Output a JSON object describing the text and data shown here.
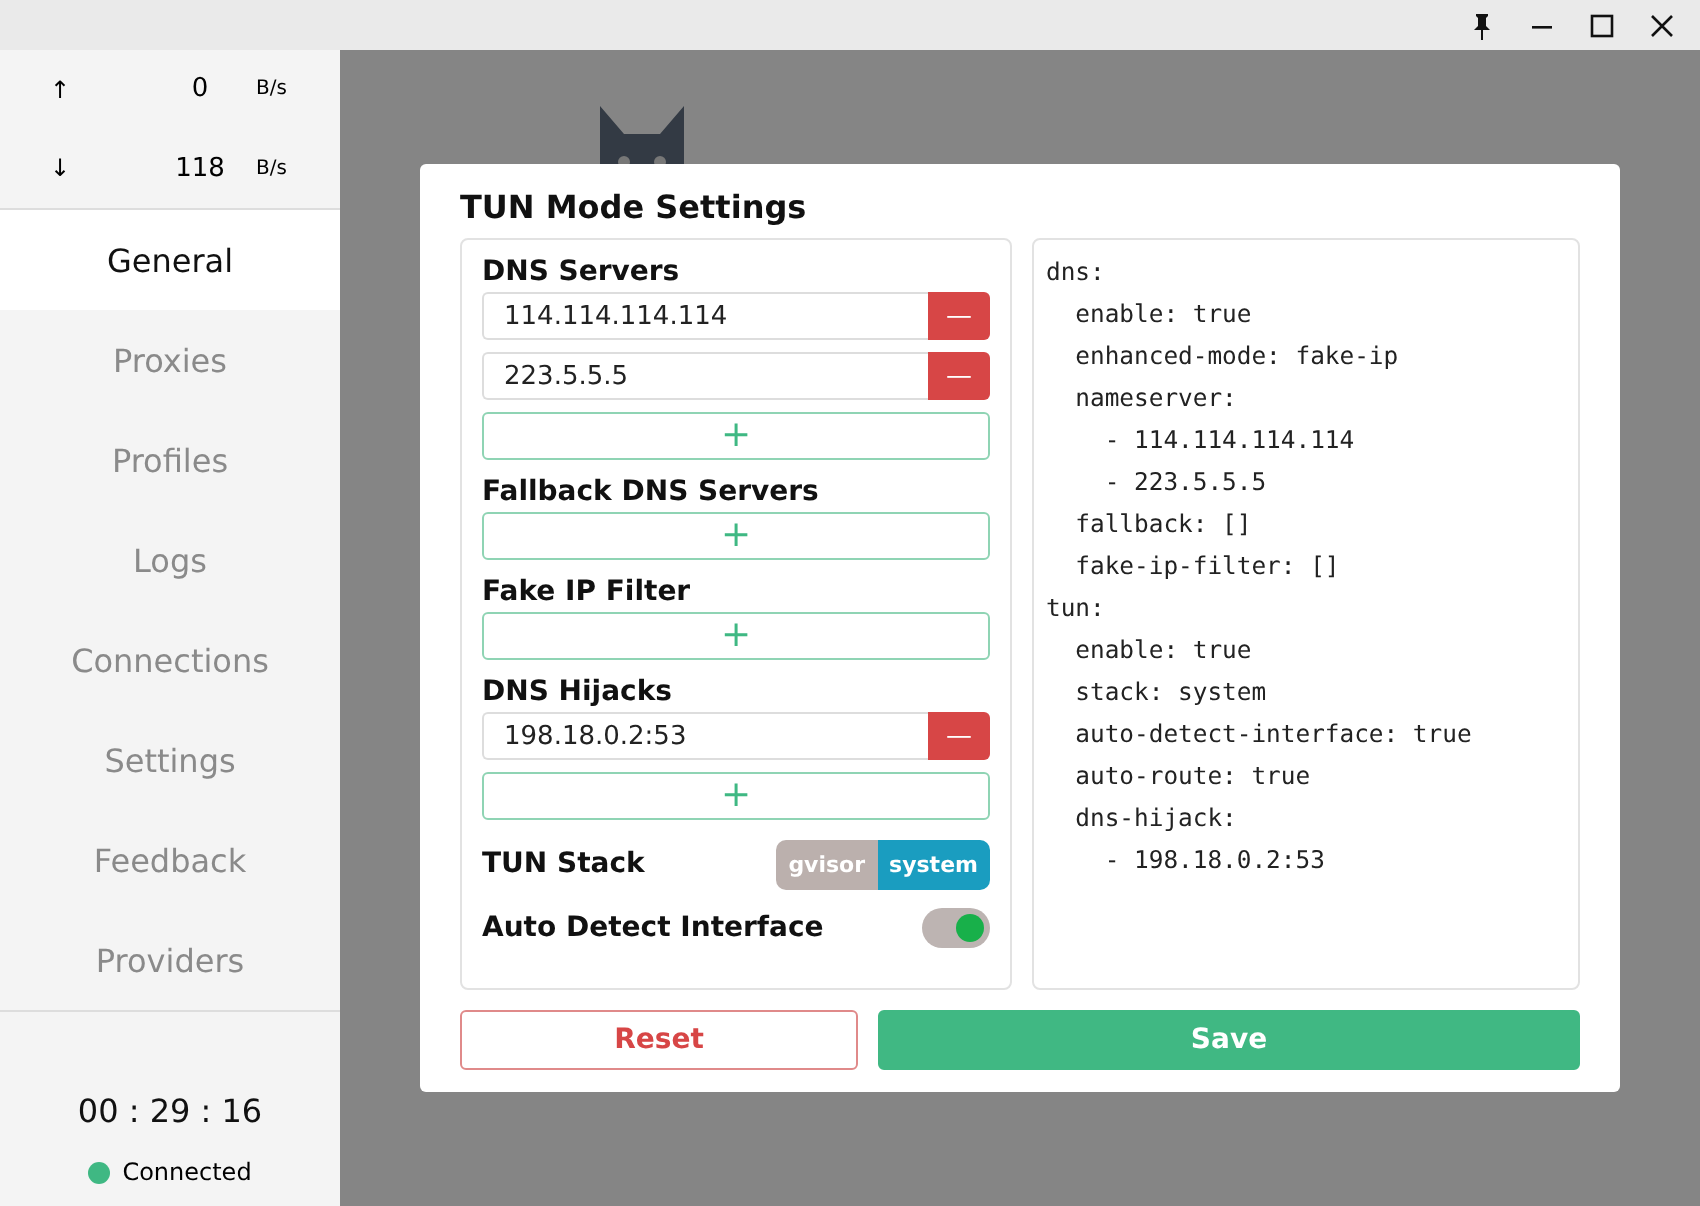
{
  "traffic": [
    {
      "arrow": "↑",
      "value": "0",
      "unit": "B/s"
    },
    {
      "arrow": "↓",
      "value": "118",
      "unit": "B/s"
    }
  ],
  "nav": [
    {
      "label": "General",
      "selected": true
    },
    {
      "label": "Proxies",
      "selected": false
    },
    {
      "label": "Profiles",
      "selected": false
    },
    {
      "label": "Logs",
      "selected": false
    },
    {
      "label": "Connections",
      "selected": false
    },
    {
      "label": "Settings",
      "selected": false
    },
    {
      "label": "Feedback",
      "selected": false
    },
    {
      "label": "Providers",
      "selected": false
    }
  ],
  "timer": "00 : 29 : 16",
  "status": {
    "label": "Connected",
    "color": "#3fb883"
  },
  "dialog": {
    "title": "TUN Mode Settings",
    "sections": [
      {
        "kind": "list",
        "title": "DNS Servers",
        "entries": [
          "114.114.114.114",
          "223.5.5.5"
        ],
        "add": "+",
        "remove": "—"
      },
      {
        "kind": "list",
        "title": "Fallback DNS Servers",
        "add": "+"
      },
      {
        "kind": "list",
        "title": "Fake IP Filter",
        "add": "+"
      },
      {
        "kind": "list",
        "title": "DNS Hijacks",
        "entries": [
          "198.18.0.2:53"
        ],
        "add": "+",
        "remove": "—"
      },
      {
        "kind": "segmented",
        "title": "TUN Stack",
        "options": [
          {
            "label": "gvisor",
            "selected": false
          },
          {
            "label": "system",
            "selected": true
          }
        ]
      },
      {
        "kind": "switch",
        "title": "Auto Detect Interface",
        "on": true
      }
    ],
    "yaml": [
      "dns:",
      "  enable: true",
      "  enhanced-mode: fake-ip",
      "  nameserver:",
      "    - 114.114.114.114",
      "    - 223.5.5.5",
      "  fallback: []",
      "  fake-ip-filter: []",
      "tun:",
      "  enable: true",
      "  stack: system",
      "  auto-detect-interface: true",
      "  auto-route: true",
      "  dns-hijack:",
      "    - 198.18.0.2:53"
    ],
    "buttons": [
      {
        "kind": "reset",
        "label": "Reset"
      },
      {
        "kind": "save",
        "label": "Save"
      }
    ]
  }
}
